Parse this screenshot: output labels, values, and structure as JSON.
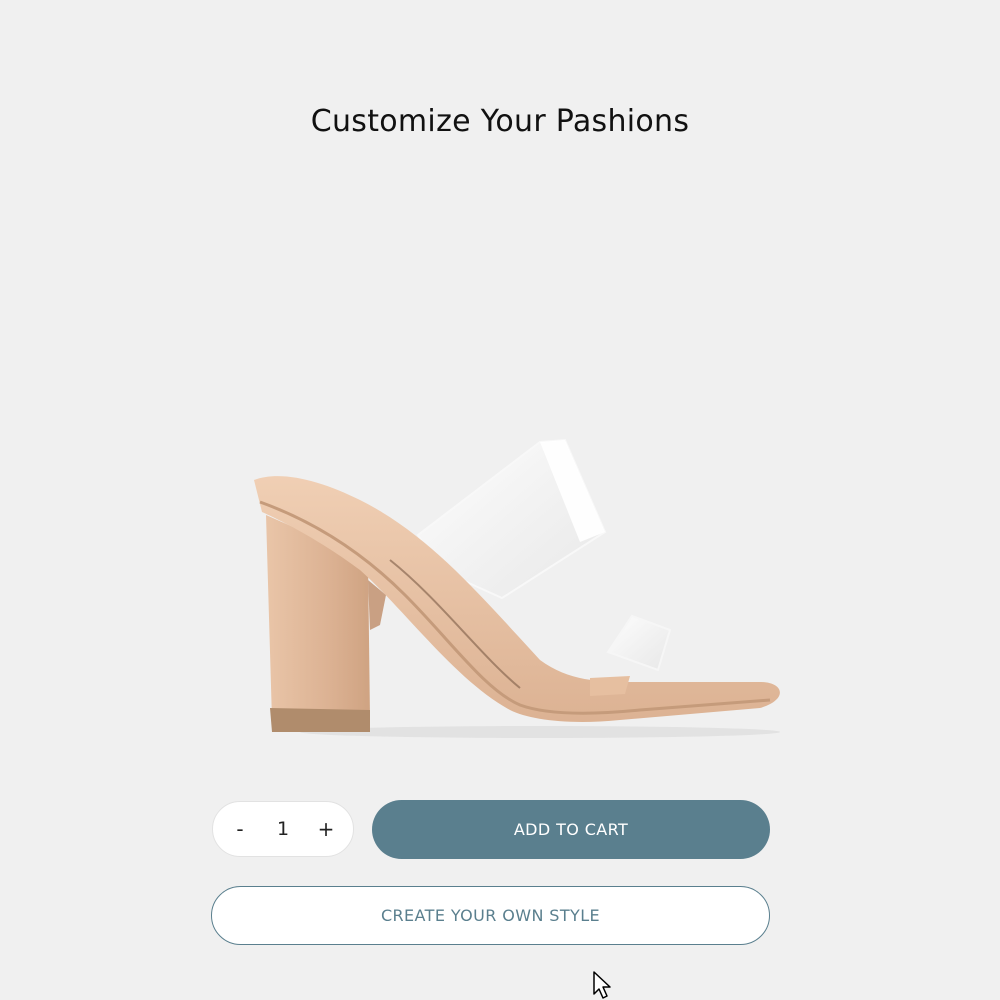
{
  "page": {
    "title": "Customize Your Pashions"
  },
  "product": {
    "image_icon": "heel-sandal-image"
  },
  "quantity": {
    "decrement_label": "-",
    "value": "1",
    "increment_label": "+"
  },
  "actions": {
    "add_to_cart_label": "ADD TO CART",
    "create_style_label": "CREATE YOUR OWN STYLE"
  },
  "colors": {
    "background": "#f0f0f0",
    "primary": "#5a7f8e",
    "outline_text": "#5a7f8e",
    "shoe": "#e8c2a5"
  }
}
